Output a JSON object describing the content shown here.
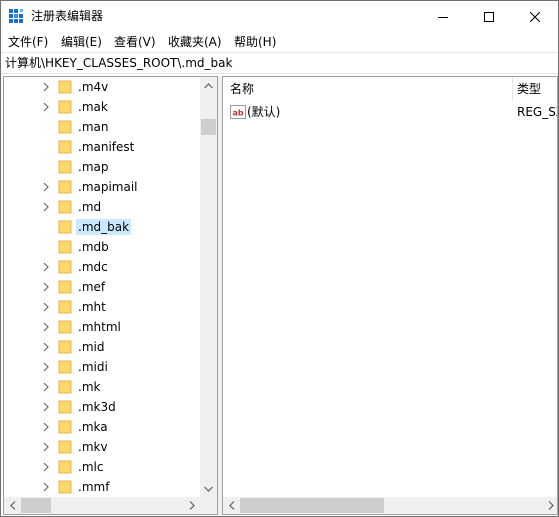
{
  "window": {
    "title": "注册表编辑器"
  },
  "menu": [
    "文件(F)",
    "编辑(E)",
    "查看(V)",
    "收藏夹(A)",
    "帮助(H)"
  ],
  "address": "计算机\\HKEY_CLASSES_ROOT\\.md_bak",
  "tree": {
    "items": [
      {
        "label": ".m4v",
        "expandable": true
      },
      {
        "label": ".mak",
        "expandable": true
      },
      {
        "label": ".man",
        "expandable": false
      },
      {
        "label": ".manifest",
        "expandable": false
      },
      {
        "label": ".map",
        "expandable": false
      },
      {
        "label": ".mapimail",
        "expandable": true
      },
      {
        "label": ".md",
        "expandable": true
      },
      {
        "label": ".md_bak",
        "expandable": false,
        "selected": true
      },
      {
        "label": ".mdb",
        "expandable": false
      },
      {
        "label": ".mdc",
        "expandable": true
      },
      {
        "label": ".mef",
        "expandable": true
      },
      {
        "label": ".mht",
        "expandable": true
      },
      {
        "label": ".mhtml",
        "expandable": true
      },
      {
        "label": ".mid",
        "expandable": true
      },
      {
        "label": ".midi",
        "expandable": true
      },
      {
        "label": ".mk",
        "expandable": true
      },
      {
        "label": ".mk3d",
        "expandable": true
      },
      {
        "label": ".mka",
        "expandable": true
      },
      {
        "label": ".mkv",
        "expandable": true
      },
      {
        "label": ".mlc",
        "expandable": true
      },
      {
        "label": ".mmf",
        "expandable": true
      }
    ]
  },
  "list": {
    "columns": {
      "name": "名称",
      "type": "类型"
    },
    "rows": [
      {
        "name": "(默认)",
        "type": "REG_SZ",
        "icon": "string-value-icon"
      }
    ]
  },
  "colors": {
    "selection": "#cce8ff",
    "folder": "#ffd86b",
    "scrollbar_thumb": "#cdcdcd"
  }
}
